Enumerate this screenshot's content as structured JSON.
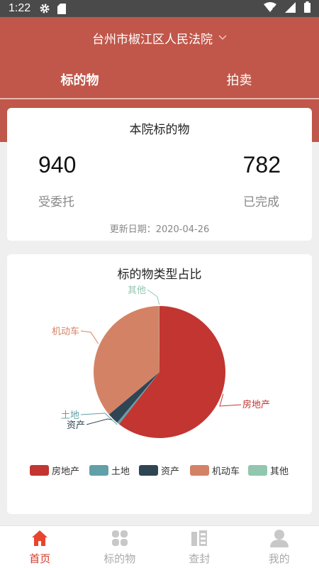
{
  "status_bar": {
    "time": "1:22"
  },
  "header": {
    "court": "台州市椒江区人民法院",
    "tabs": [
      {
        "label": "标的物",
        "active": true
      },
      {
        "label": "拍卖",
        "active": false
      }
    ]
  },
  "stats": {
    "title": "本院标的物",
    "entrusted_value": "940",
    "entrusted_label": "受委托",
    "completed_value": "782",
    "completed_label": "已完成",
    "update_text": "更新日期：2020-04-26"
  },
  "chart": {
    "title": "标的物类型占比"
  },
  "chart_data": {
    "type": "pie",
    "title": "标的物类型占比",
    "legend_position": "bottom",
    "categories": [
      "房地产",
      "土地",
      "资产",
      "机动车",
      "其他"
    ],
    "values": [
      60.5,
      0.6,
      2.8,
      36.0,
      0.1
    ],
    "colors": [
      "#c23531",
      "#61a0a8",
      "#2f4554",
      "#d48265",
      "#91c7ae"
    ]
  },
  "bottom_nav": [
    {
      "label": "首页",
      "icon": "home-icon",
      "active": true
    },
    {
      "label": "标的物",
      "icon": "grid-icon",
      "active": false
    },
    {
      "label": "查封",
      "icon": "seal-icon",
      "active": false
    },
    {
      "label": "我的",
      "icon": "user-icon",
      "active": false
    }
  ],
  "colors": {
    "brand": "#c0574a",
    "nav_active": "#d33b2c"
  }
}
